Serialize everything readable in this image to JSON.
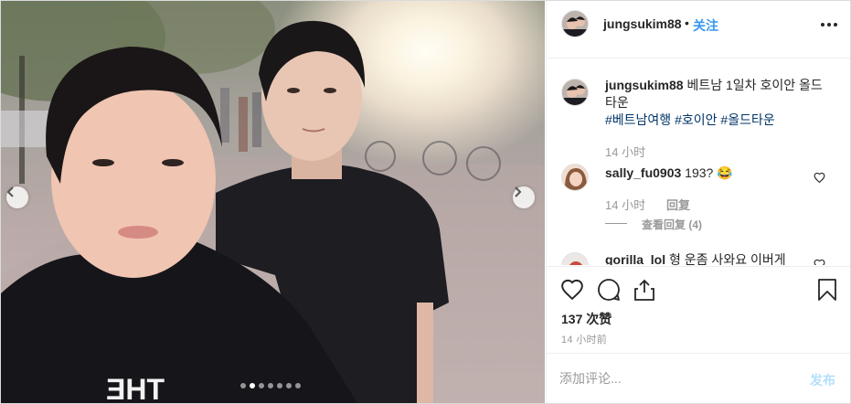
{
  "photo": {
    "slide_count": 7,
    "active_slide": 2,
    "shirt_print": "ƎHT"
  },
  "header": {
    "username": "jungsukim88",
    "separator": "•",
    "follow_label": "关注",
    "more_icon": "more-horizontal-icon"
  },
  "caption": {
    "username": "jungsukim88",
    "text": " 베트남 1일차 호이안 올드타운",
    "hashtags": [
      "#베트남여행",
      "#호이안",
      "#올드타운"
    ],
    "time": "14 小时"
  },
  "comments": [
    {
      "username": "sally_fu0903",
      "text": " 193? 😂",
      "time": "14 小时",
      "reply_label": "回复",
      "view_replies": "查看回复 (4)"
    },
    {
      "username": "gorilla_lol",
      "text": " 형 운좀 사와요 이버게"
    }
  ],
  "actions": {
    "like_icon": "heart-icon",
    "comment_icon": "comment-icon",
    "share_icon": "share-icon",
    "save_icon": "bookmark-icon",
    "likes": "137 次赞",
    "post_time": "14 小时前"
  },
  "add_comment": {
    "placeholder": "添加评论...",
    "post_label": "发布"
  },
  "colors": {
    "link": "#3897f0",
    "hashtag": "#003569",
    "muted": "#999999",
    "post_disabled": "#b2dffc"
  }
}
